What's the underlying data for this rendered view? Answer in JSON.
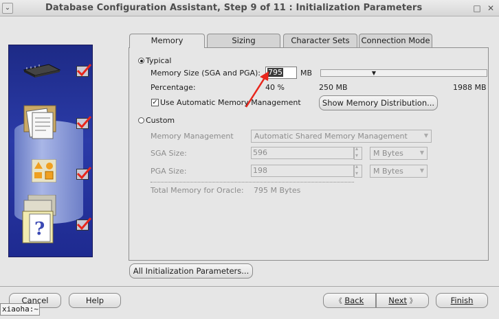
{
  "window": {
    "title": "Database Configuration Assistant, Step 9 of 11 : Initialization Parameters",
    "close_glyph": "✕",
    "maximize_glyph": "□"
  },
  "tabs": [
    {
      "label": "Memory",
      "active": true
    },
    {
      "label": "Sizing",
      "active": false
    },
    {
      "label": "Character Sets",
      "active": false
    },
    {
      "label": "Connection Mode",
      "active": false
    }
  ],
  "memory": {
    "typical_label": "Typical",
    "typical_selected": true,
    "memory_size_label": "Memory Size (SGA and PGA):",
    "memory_size_value": "795",
    "memory_size_unit": "MB",
    "percentage_label": "Percentage:",
    "percentage_value": "40 %",
    "slider_min": "250 MB",
    "slider_max": "1988 MB",
    "use_amm_label": "Use Automatic Memory Management",
    "use_amm_checked": true,
    "show_distribution_button": "Show Memory Distribution...",
    "custom_label": "Custom",
    "custom_selected": false,
    "memory_management_label": "Memory Management",
    "memory_management_value": "Automatic Shared Memory Management",
    "sga_label": "SGA Size:",
    "sga_value": "596",
    "sga_unit": "M Bytes",
    "pga_label": "PGA Size:",
    "pga_value": "198",
    "pga_unit": "M Bytes",
    "total_memory_label": "Total Memory for Oracle:",
    "total_memory_value": "795 M Bytes"
  },
  "all_params_button": "All Initialization Parameters...",
  "footer": {
    "cancel": "Cancel",
    "help": "Help",
    "back": "Back",
    "next": "Next",
    "finish": "Finish"
  },
  "terminal_tab": "xiaoha:~",
  "colors": {
    "accent_red": "#e8261c",
    "side_panel": "#2b3ba8"
  }
}
